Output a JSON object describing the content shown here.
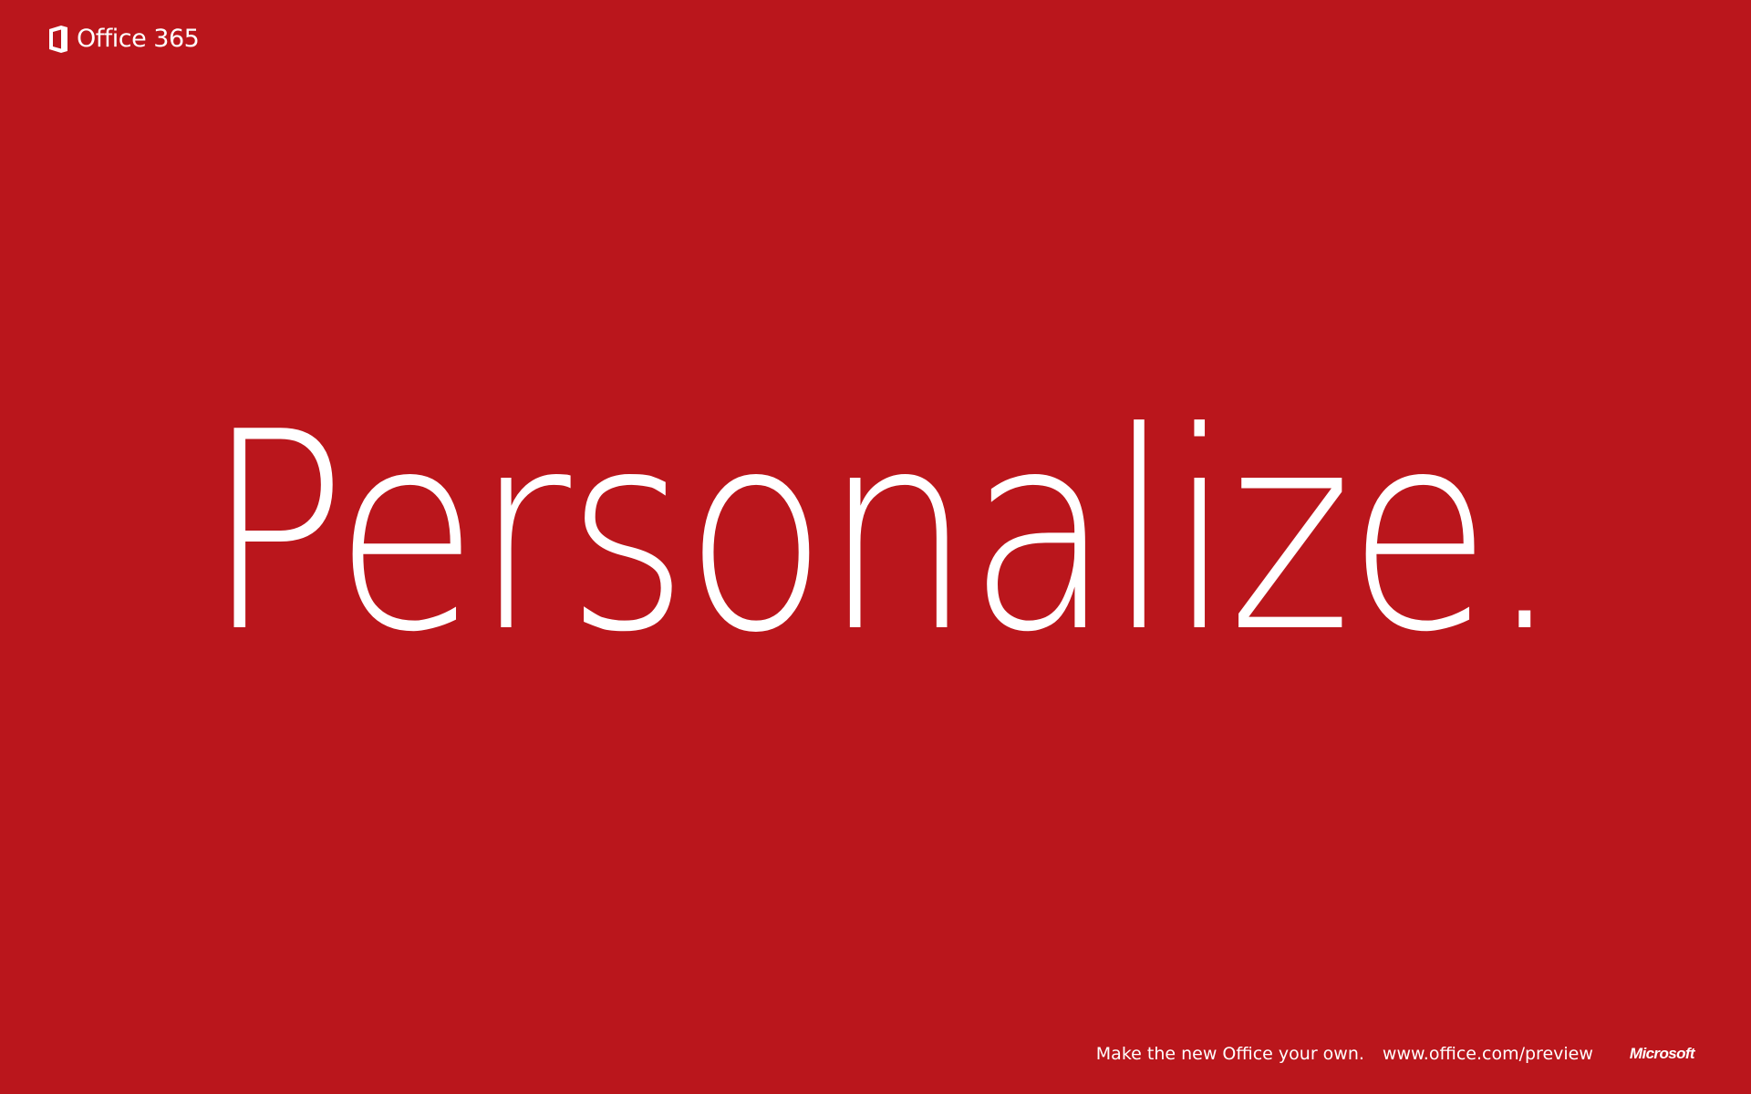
{
  "brand": {
    "icon": "office-logo-icon",
    "name": "Office 365"
  },
  "headline": "Personalize.",
  "footer": {
    "tagline": "Make the new Office your own.",
    "url": "www.office.com/preview",
    "company_logo": "Microsoft"
  },
  "colors": {
    "background": "#BA161C",
    "text": "#FFFFFF"
  }
}
